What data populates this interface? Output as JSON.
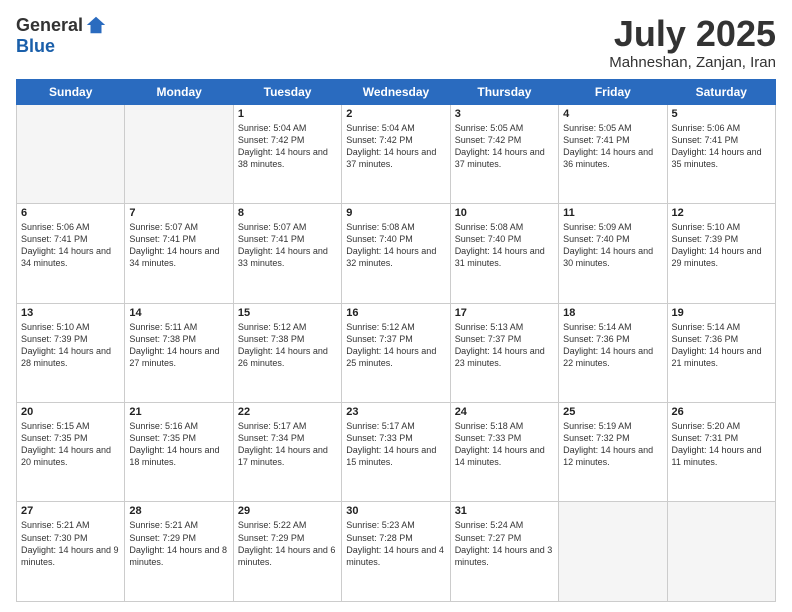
{
  "logo": {
    "general": "General",
    "blue": "Blue"
  },
  "header": {
    "month": "July 2025",
    "location": "Mahneshan, Zanjan, Iran"
  },
  "weekdays": [
    "Sunday",
    "Monday",
    "Tuesday",
    "Wednesday",
    "Thursday",
    "Friday",
    "Saturday"
  ],
  "weeks": [
    [
      {
        "day": "",
        "data": ""
      },
      {
        "day": "",
        "data": ""
      },
      {
        "day": "1",
        "data": "Sunrise: 5:04 AM\nSunset: 7:42 PM\nDaylight: 14 hours and 38 minutes."
      },
      {
        "day": "2",
        "data": "Sunrise: 5:04 AM\nSunset: 7:42 PM\nDaylight: 14 hours and 37 minutes."
      },
      {
        "day": "3",
        "data": "Sunrise: 5:05 AM\nSunset: 7:42 PM\nDaylight: 14 hours and 37 minutes."
      },
      {
        "day": "4",
        "data": "Sunrise: 5:05 AM\nSunset: 7:41 PM\nDaylight: 14 hours and 36 minutes."
      },
      {
        "day": "5",
        "data": "Sunrise: 5:06 AM\nSunset: 7:41 PM\nDaylight: 14 hours and 35 minutes."
      }
    ],
    [
      {
        "day": "6",
        "data": "Sunrise: 5:06 AM\nSunset: 7:41 PM\nDaylight: 14 hours and 34 minutes."
      },
      {
        "day": "7",
        "data": "Sunrise: 5:07 AM\nSunset: 7:41 PM\nDaylight: 14 hours and 34 minutes."
      },
      {
        "day": "8",
        "data": "Sunrise: 5:07 AM\nSunset: 7:41 PM\nDaylight: 14 hours and 33 minutes."
      },
      {
        "day": "9",
        "data": "Sunrise: 5:08 AM\nSunset: 7:40 PM\nDaylight: 14 hours and 32 minutes."
      },
      {
        "day": "10",
        "data": "Sunrise: 5:08 AM\nSunset: 7:40 PM\nDaylight: 14 hours and 31 minutes."
      },
      {
        "day": "11",
        "data": "Sunrise: 5:09 AM\nSunset: 7:40 PM\nDaylight: 14 hours and 30 minutes."
      },
      {
        "day": "12",
        "data": "Sunrise: 5:10 AM\nSunset: 7:39 PM\nDaylight: 14 hours and 29 minutes."
      }
    ],
    [
      {
        "day": "13",
        "data": "Sunrise: 5:10 AM\nSunset: 7:39 PM\nDaylight: 14 hours and 28 minutes."
      },
      {
        "day": "14",
        "data": "Sunrise: 5:11 AM\nSunset: 7:38 PM\nDaylight: 14 hours and 27 minutes."
      },
      {
        "day": "15",
        "data": "Sunrise: 5:12 AM\nSunset: 7:38 PM\nDaylight: 14 hours and 26 minutes."
      },
      {
        "day": "16",
        "data": "Sunrise: 5:12 AM\nSunset: 7:37 PM\nDaylight: 14 hours and 25 minutes."
      },
      {
        "day": "17",
        "data": "Sunrise: 5:13 AM\nSunset: 7:37 PM\nDaylight: 14 hours and 23 minutes."
      },
      {
        "day": "18",
        "data": "Sunrise: 5:14 AM\nSunset: 7:36 PM\nDaylight: 14 hours and 22 minutes."
      },
      {
        "day": "19",
        "data": "Sunrise: 5:14 AM\nSunset: 7:36 PM\nDaylight: 14 hours and 21 minutes."
      }
    ],
    [
      {
        "day": "20",
        "data": "Sunrise: 5:15 AM\nSunset: 7:35 PM\nDaylight: 14 hours and 20 minutes."
      },
      {
        "day": "21",
        "data": "Sunrise: 5:16 AM\nSunset: 7:35 PM\nDaylight: 14 hours and 18 minutes."
      },
      {
        "day": "22",
        "data": "Sunrise: 5:17 AM\nSunset: 7:34 PM\nDaylight: 14 hours and 17 minutes."
      },
      {
        "day": "23",
        "data": "Sunrise: 5:17 AM\nSunset: 7:33 PM\nDaylight: 14 hours and 15 minutes."
      },
      {
        "day": "24",
        "data": "Sunrise: 5:18 AM\nSunset: 7:33 PM\nDaylight: 14 hours and 14 minutes."
      },
      {
        "day": "25",
        "data": "Sunrise: 5:19 AM\nSunset: 7:32 PM\nDaylight: 14 hours and 12 minutes."
      },
      {
        "day": "26",
        "data": "Sunrise: 5:20 AM\nSunset: 7:31 PM\nDaylight: 14 hours and 11 minutes."
      }
    ],
    [
      {
        "day": "27",
        "data": "Sunrise: 5:21 AM\nSunset: 7:30 PM\nDaylight: 14 hours and 9 minutes."
      },
      {
        "day": "28",
        "data": "Sunrise: 5:21 AM\nSunset: 7:29 PM\nDaylight: 14 hours and 8 minutes."
      },
      {
        "day": "29",
        "data": "Sunrise: 5:22 AM\nSunset: 7:29 PM\nDaylight: 14 hours and 6 minutes."
      },
      {
        "day": "30",
        "data": "Sunrise: 5:23 AM\nSunset: 7:28 PM\nDaylight: 14 hours and 4 minutes."
      },
      {
        "day": "31",
        "data": "Sunrise: 5:24 AM\nSunset: 7:27 PM\nDaylight: 14 hours and 3 minutes."
      },
      {
        "day": "",
        "data": ""
      },
      {
        "day": "",
        "data": ""
      }
    ]
  ]
}
